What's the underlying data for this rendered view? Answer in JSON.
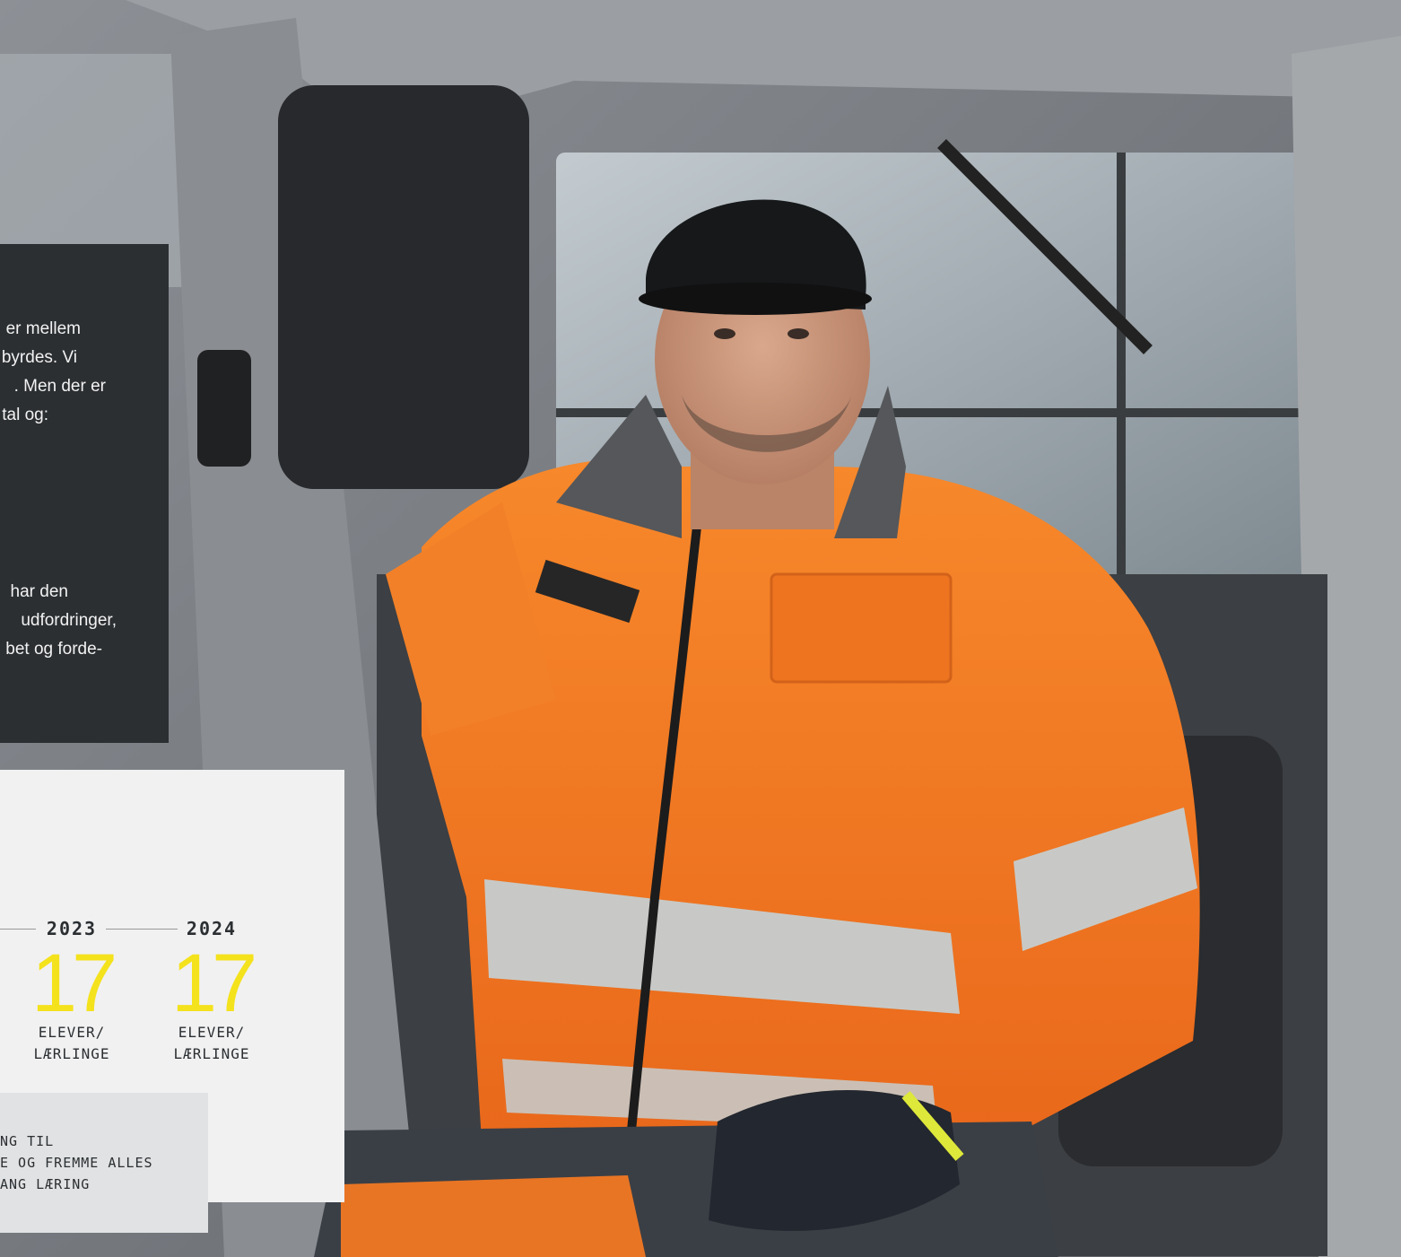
{
  "intro_panel": {
    "lines_top": [
      "er mellem",
      "byrdes. Vi",
      ". Men der er",
      "tal og:"
    ],
    "lines_bottom": [
      "har den",
      "udfordringer,",
      "bet og forde-"
    ]
  },
  "stats": [
    {
      "year": "2023",
      "value": "17",
      "label_line1": "ELEVER/",
      "label_line2": "LÆRLINGE"
    },
    {
      "year": "2024",
      "value": "17",
      "label_line1": "ELEVER/",
      "label_line2": "LÆRLINGE"
    }
  ],
  "quote": {
    "lines": [
      "NG TIL",
      "E OG FREMME ALLES",
      "ANG LÆRING"
    ]
  },
  "colors": {
    "dark_panel": "#2b2f32",
    "light_panel": "#f1f1f2",
    "quote_box": "#e1e2e3",
    "accent_yellow": "#f4e21d",
    "jacket_orange": "#f07a22"
  }
}
